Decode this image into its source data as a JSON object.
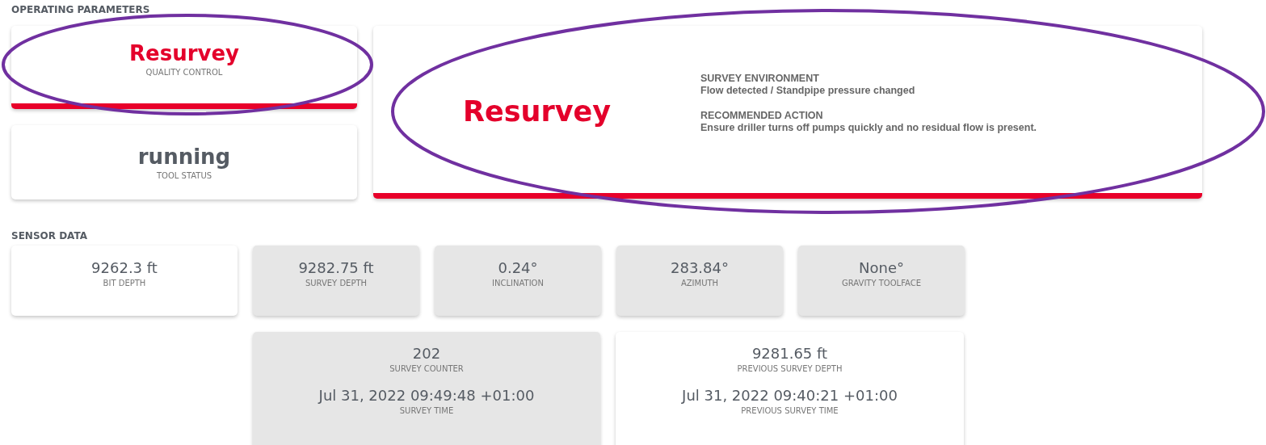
{
  "operating_parameters": {
    "heading": "OPERATING PARAMETERS",
    "status_cards": [
      {
        "value": "Resurvey",
        "label": "QUALITY CONTROL",
        "alert": true
      },
      {
        "value": "running",
        "label": "TOOL STATUS",
        "alert": false
      }
    ],
    "detail_card": {
      "value": "Resurvey",
      "alert": true,
      "sections": [
        {
          "title": "SURVEY ENVIRONMENT",
          "text": "Flow detected / Standpipe pressure changed"
        },
        {
          "title": "RECOMMENDED ACTION",
          "text": "Ensure driller turns off pumps quickly and no residual flow is present."
        }
      ]
    }
  },
  "sensor_data": {
    "heading": "SENSOR DATA",
    "cards": [
      {
        "value": "9262.3 ft",
        "label": "BIT DEPTH",
        "shaded": false
      },
      {
        "value": "9282.75 ft",
        "label": "SURVEY DEPTH",
        "shaded": true
      },
      {
        "value": "0.24°",
        "label": "INCLINATION",
        "shaded": true
      },
      {
        "value": "283.84°",
        "label": "AZIMUTH",
        "shaded": true
      },
      {
        "value": "None°",
        "label": "GRAVITY TOOLFACE",
        "shaded": true
      }
    ],
    "survey_cards": [
      {
        "shaded": true,
        "items": [
          {
            "value": "202",
            "label": "SURVEY COUNTER"
          },
          {
            "value": "Jul 31, 2022 09:49:48 +01:00",
            "label": "SURVEY TIME"
          }
        ]
      },
      {
        "shaded": false,
        "items": [
          {
            "value": "9281.65 ft",
            "label": "PREVIOUS SURVEY DEPTH"
          },
          {
            "value": "Jul 31, 2022 09:40:21 +01:00",
            "label": "PREVIOUS SURVEY TIME"
          }
        ]
      }
    ]
  }
}
